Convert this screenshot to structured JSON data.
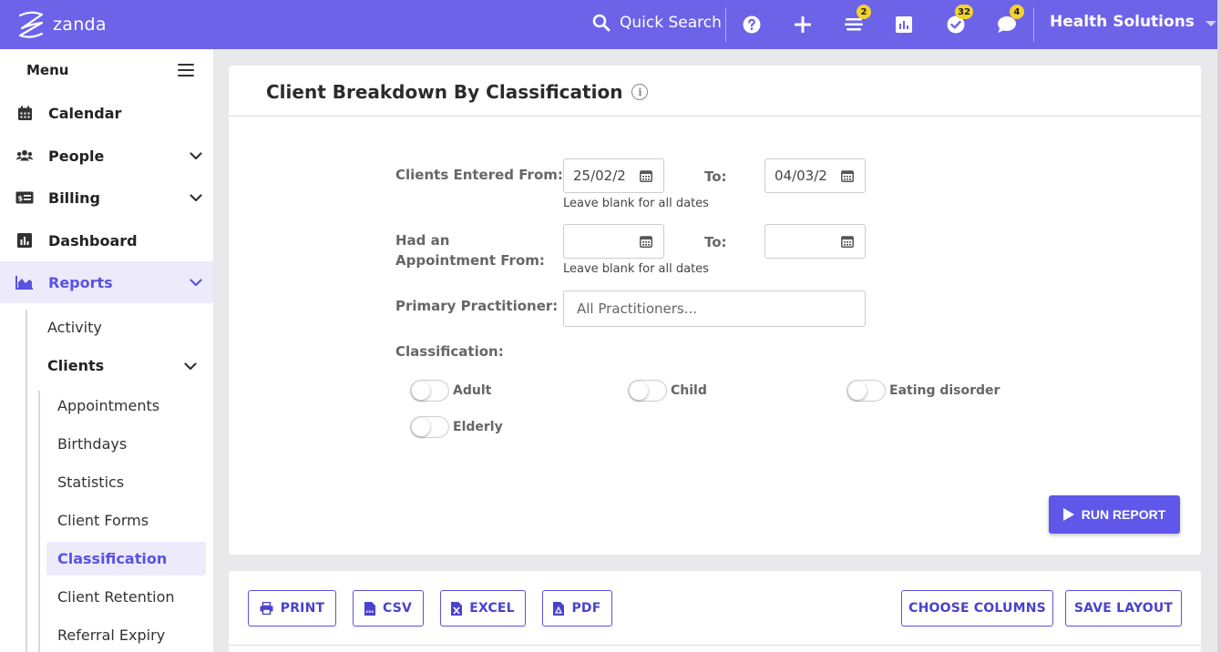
{
  "topbar": {
    "logo_text": "zanda",
    "search_label": "Quick Search",
    "badges": {
      "queue": "2",
      "tasks": "32",
      "messages": "4"
    },
    "account_name": "Health Solutions"
  },
  "sidebar": {
    "menu_label": "Menu",
    "items": [
      {
        "label": "Calendar",
        "icon": "calendar-icon"
      },
      {
        "label": "People",
        "icon": "people-icon"
      },
      {
        "label": "Billing",
        "icon": "billing-icon"
      },
      {
        "label": "Dashboard",
        "icon": "dashboard-icon"
      },
      {
        "label": "Reports",
        "icon": "reports-icon"
      }
    ],
    "reports_sub": {
      "activity": "Activity",
      "clients": "Clients"
    },
    "clients_sub": [
      "Appointments",
      "Birthdays",
      "Statistics",
      "Client Forms",
      "Classification",
      "Client Retention",
      "Referral Expiry"
    ]
  },
  "report": {
    "title": "Client Breakdown By Classification",
    "clients_entered_label": "Clients Entered From:",
    "to_label": "To:",
    "entered_from_value": "25/02/2",
    "entered_to_value": "04/03/2",
    "hint": "Leave blank for all dates",
    "appointment_label": "Had an Appointment From:",
    "practitioner_label": "Primary Practitioner:",
    "practitioner_placeholder": "All Practitioners...",
    "classification_label": "Classification:",
    "classifications": [
      "Adult",
      "Child",
      "Eating disorder",
      "Elderly"
    ],
    "run_label": "RUN REPORT"
  },
  "export": {
    "print": "PRINT",
    "csv": "CSV",
    "excel": "EXCEL",
    "pdf": "PDF",
    "choose_columns": "CHOOSE COLUMNS",
    "save_layout": "SAVE LAYOUT"
  },
  "colors": {
    "brand": "#6c63e9",
    "accent": "#5b52e0",
    "badge": "#f3d22e"
  }
}
